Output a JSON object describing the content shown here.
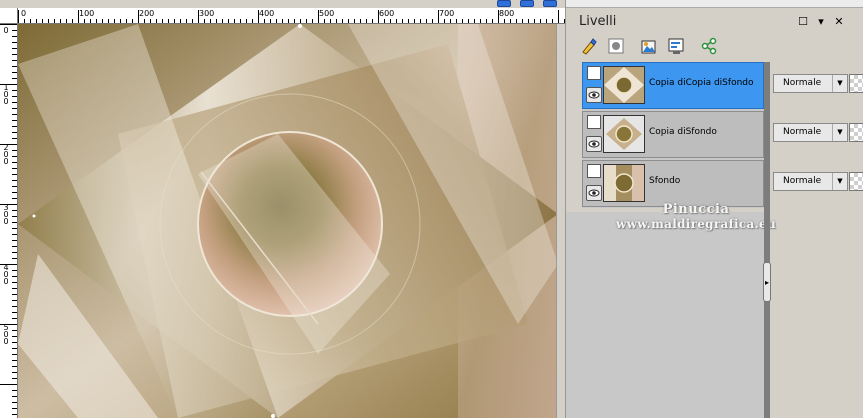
{
  "ruler": {
    "h_labels": [
      "0",
      "100",
      "200",
      "300",
      "400",
      "500",
      "600",
      "700",
      "800"
    ],
    "v_labels": [
      [
        "0"
      ],
      [
        "1",
        "0",
        "0"
      ],
      [
        "2",
        "0",
        "0"
      ],
      [
        "3",
        "0",
        "0"
      ],
      [
        "4",
        "0",
        "0"
      ],
      [
        "5",
        "0",
        "0"
      ]
    ]
  },
  "panel": {
    "title": "Livelli",
    "restore_glyph": "☐",
    "menu_glyph": "▾",
    "close_glyph": "✕"
  },
  "toolbar": {
    "icons": [
      "brush-icon",
      "mask-icon",
      "group-icon",
      "properties-icon",
      "share-icon"
    ]
  },
  "layers": [
    {
      "name": "Copia diCopia diSfondo",
      "blend_mode": "Normale",
      "selected": true
    },
    {
      "name": "Copia diSfondo",
      "blend_mode": "Normale",
      "selected": false
    },
    {
      "name": "Sfondo",
      "blend_mode": "Normale",
      "selected": false
    }
  ],
  "watermark": {
    "line1": "Pinuccia",
    "line2": "www.maldiregrafica.eu"
  },
  "colors": {
    "selection": "#3d96ef",
    "panel_bg": "#d4d0c8",
    "canvas_olive": "#8a7640",
    "canvas_cream": "#f1ebe0"
  }
}
